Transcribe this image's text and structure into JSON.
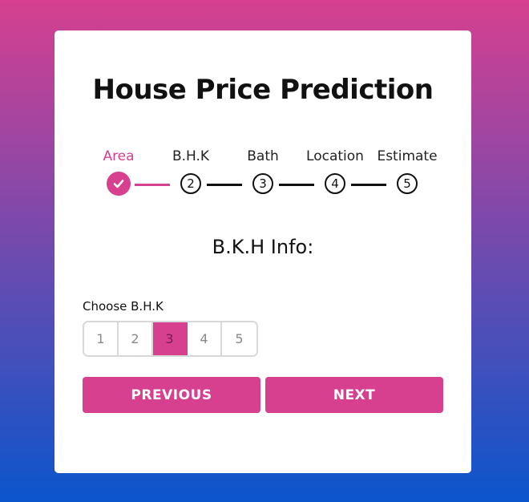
{
  "title": "House Price Prediction",
  "colors": {
    "accent": "#d6408f",
    "gradient_top": "#d6408f",
    "gradient_bottom": "#0b55cc"
  },
  "steps": [
    {
      "label": "Area",
      "number": "1",
      "state": "done"
    },
    {
      "label": "B.H.K",
      "number": "2",
      "state": "pending"
    },
    {
      "label": "Bath",
      "number": "3",
      "state": "pending"
    },
    {
      "label": "Location",
      "number": "4",
      "state": "pending"
    },
    {
      "label": "Estimate",
      "number": "5",
      "state": "pending"
    }
  ],
  "step_icon": "check-icon",
  "subtitle": "B.K.H Info:",
  "bhk": {
    "label": "Choose B.H.K",
    "options": [
      "1",
      "2",
      "3",
      "4",
      "5"
    ],
    "selected": "3"
  },
  "buttons": {
    "previous": "PREVIOUS",
    "next": "NEXT"
  }
}
